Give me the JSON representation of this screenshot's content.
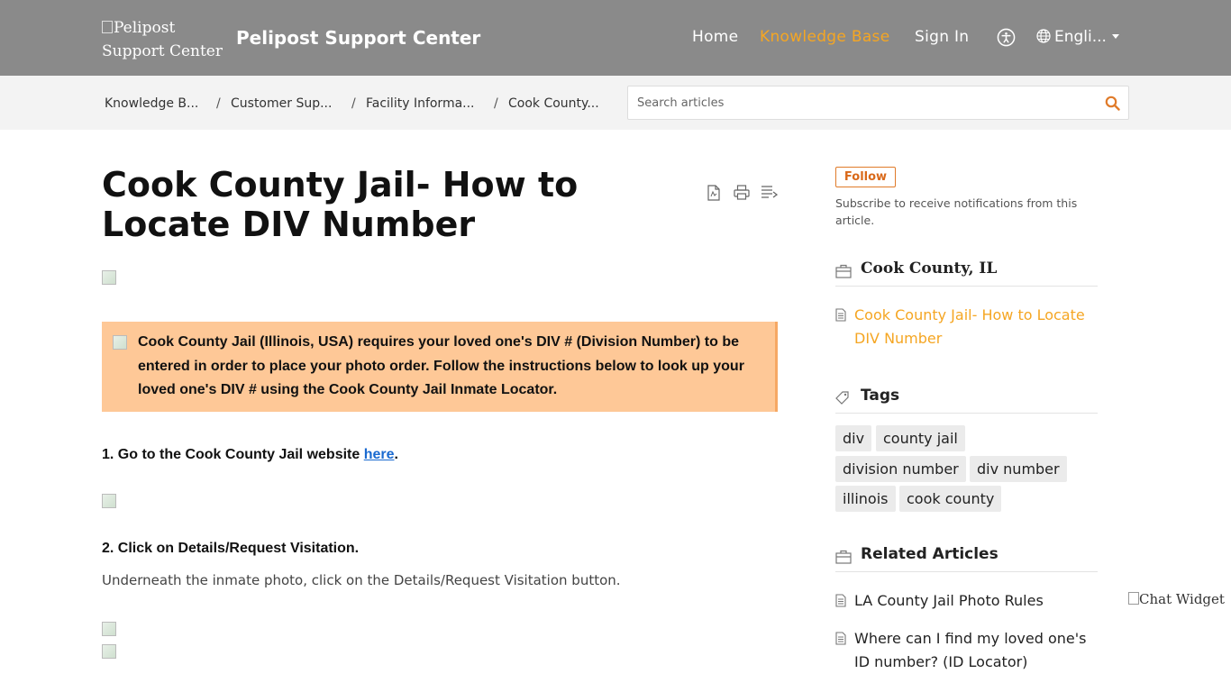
{
  "header": {
    "logo_alt": "Pelipost Support Center",
    "logo_alt_line1": "Pelipost",
    "logo_alt_line2": "Support Center",
    "site_title": "Pelipost Support Center",
    "nav": {
      "home": "Home",
      "knowledge_base": "Knowledge Base",
      "sign_in": "Sign In",
      "language": "Engli..."
    },
    "colors": {
      "bar": "#8a8a8a",
      "active": "#f5a623"
    },
    "icons": [
      "accessibility-icon",
      "globe-icon",
      "chevron-down-icon"
    ]
  },
  "breadcrumb": {
    "items": [
      "Knowledge B...",
      "Customer Sup...",
      "Facility Informa...",
      "Cook County..."
    ],
    "separator": "/"
  },
  "search": {
    "placeholder": "Search articles"
  },
  "article": {
    "title": "Cook County Jail- How to Locate DIV Number",
    "notice": "Cook County Jail (Illinois, USA) requires your loved one's DIV # (Division Number) to be entered in order to place your photo order. Follow the instructions below to look up your loved one's DIV # using the Cook County Jail Inmate Locator.",
    "step1_prefix": "1. Go to the Cook County Jail website ",
    "step1_link": "here",
    "step1_suffix": ".",
    "step2": "2. Click on Details/Request Visitation.",
    "step2_desc": "Underneath the inmate photo, click on the Details/Request Visitation button.",
    "tool_icons": [
      "pdf-icon",
      "print-icon",
      "text-size-icon"
    ],
    "notice_color": "#fec897"
  },
  "sidebar": {
    "follow_label": "Follow",
    "subscribe_text": "Subscribe to receive notifications from this article.",
    "section_heading": "Cook County, IL",
    "section_articles": [
      "Cook County Jail- How to Locate DIV Number"
    ],
    "tags_heading": "Tags",
    "tags": [
      "div",
      "county jail",
      "division number",
      "div number",
      "illinois",
      "cook county"
    ],
    "related_heading": "Related Articles",
    "related_articles": [
      "LA County Jail Photo Rules",
      "Where can I find my loved one's ID number? (ID Locator)"
    ]
  },
  "chat_widget": {
    "alt": "Chat Widget"
  }
}
